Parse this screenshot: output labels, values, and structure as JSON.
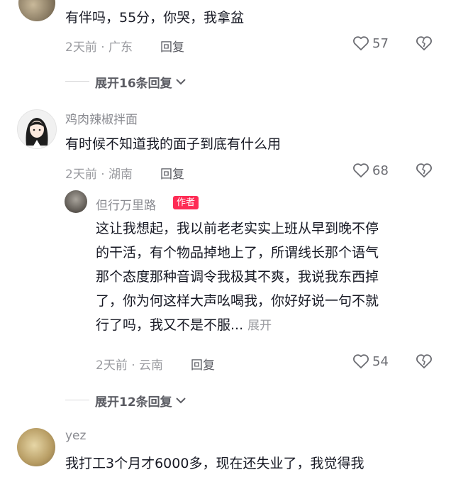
{
  "comments": [
    {
      "text": "有伴吗，55分，你哭，我拿盆",
      "time_location": "2天前 · 广东",
      "reply_label": "回复",
      "likes": "57",
      "replies_toggle": "展开16条回复"
    },
    {
      "username": "鸡肉辣椒拌面",
      "text": "有时候不知道我的面子到底有什么用",
      "time_location": "2天前 · 湖南",
      "reply_label": "回复",
      "likes": "68",
      "reply": {
        "username": "但行万里路",
        "author_tag": "作者",
        "lines": [
          "这让我想起，我以前老老实实上班从早到晚不停",
          "的干活，有个物品掉地上了，所谓线长那个语气",
          "那个态度那种音调令我极其不爽，我说我东西掉",
          "了，你为何这样大声吆喝我，你好好说一句不就",
          "行了吗，我又不是不服..."
        ],
        "expand_label": "展开",
        "time_location": "2天前 · 云南",
        "reply_label": "回复",
        "likes": "54"
      },
      "replies_toggle": "展开12条回复"
    },
    {
      "username": "yez",
      "text": "我打工3个月才6000多，现在还失业了，我觉得我"
    }
  ],
  "colors": {
    "author_tag": "#fe2c55",
    "text": "#161823",
    "muted": "#9a9ba0"
  },
  "icons": [
    "heart-icon",
    "dislike-icon",
    "chevron-down-icon"
  ]
}
